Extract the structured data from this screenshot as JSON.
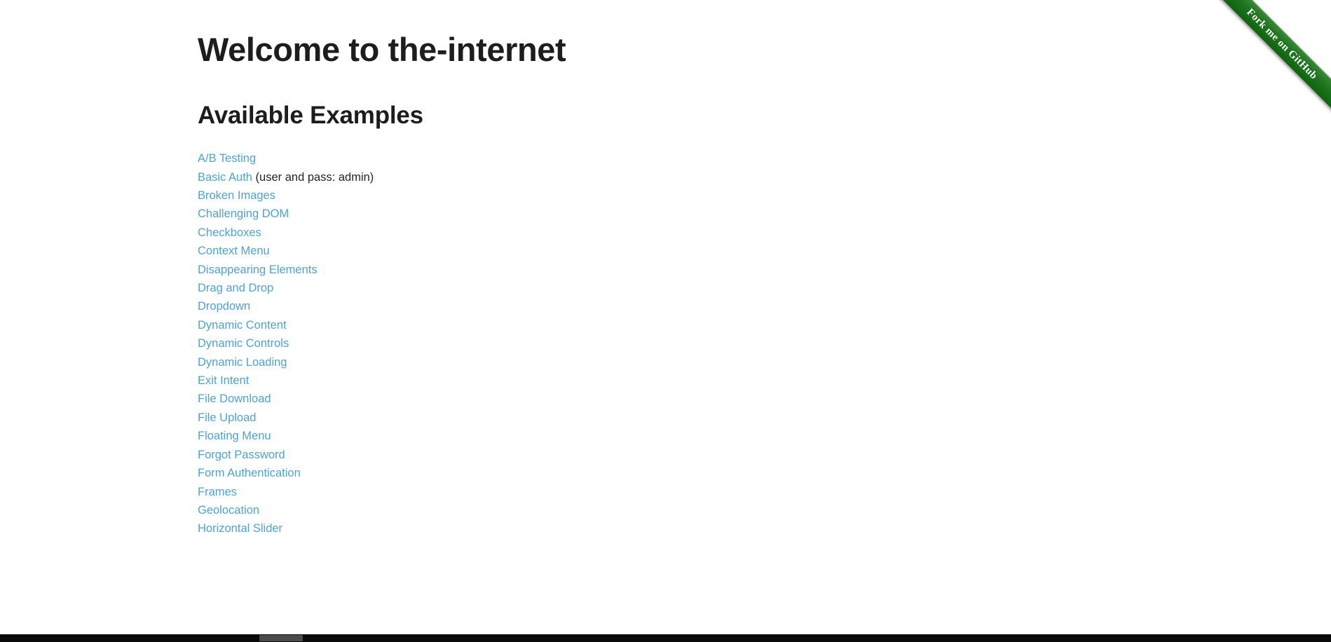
{
  "page": {
    "title": "Welcome to the-internet",
    "section_heading": "Available Examples"
  },
  "ribbon": {
    "label": "Fork me on GitHub",
    "color": "#127012",
    "text_color": "#ffffff"
  },
  "theme": {
    "background": "#ffffff",
    "heading_color": "#1d1d1d",
    "link_color": "#4fa3d1",
    "body_text_color": "#252525"
  },
  "examples": [
    {
      "label": "A/B Testing",
      "note": ""
    },
    {
      "label": "Basic Auth",
      "note": " (user and pass: admin)"
    },
    {
      "label": "Broken Images",
      "note": ""
    },
    {
      "label": "Challenging DOM",
      "note": ""
    },
    {
      "label": "Checkboxes",
      "note": ""
    },
    {
      "label": "Context Menu",
      "note": ""
    },
    {
      "label": "Disappearing Elements",
      "note": ""
    },
    {
      "label": "Drag and Drop",
      "note": ""
    },
    {
      "label": "Dropdown",
      "note": ""
    },
    {
      "label": "Dynamic Content",
      "note": ""
    },
    {
      "label": "Dynamic Controls",
      "note": ""
    },
    {
      "label": "Dynamic Loading",
      "note": ""
    },
    {
      "label": "Exit Intent",
      "note": ""
    },
    {
      "label": "File Download",
      "note": ""
    },
    {
      "label": "File Upload",
      "note": ""
    },
    {
      "label": "Floating Menu",
      "note": ""
    },
    {
      "label": "Forgot Password",
      "note": ""
    },
    {
      "label": "Form Authentication",
      "note": ""
    },
    {
      "label": "Frames",
      "note": ""
    },
    {
      "label": "Geolocation",
      "note": ""
    },
    {
      "label": "Horizontal Slider",
      "note": ""
    }
  ],
  "scrollbar": {
    "orientation": "horizontal",
    "track_color": "#0a0a0a",
    "thumb_color": "#4b4b4b"
  }
}
